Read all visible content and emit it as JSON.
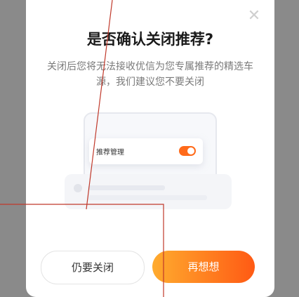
{
  "dialog": {
    "title": "是否确认关闭推荐?",
    "description": "关闭后您将无法接收优信为您专属推荐的精选车源，我们建议您不要关闭",
    "close_icon": "close-icon",
    "illustration": {
      "setting_label": "推荐管理",
      "toggle_on": true
    },
    "buttons": {
      "confirm_close": "仍要关闭",
      "keep": "再想想"
    }
  },
  "colors": {
    "accent": "#ff6a1a",
    "gradient_start": "#ffab2e",
    "gradient_end": "#ff5a14",
    "annotation_line": "#c0392b"
  }
}
